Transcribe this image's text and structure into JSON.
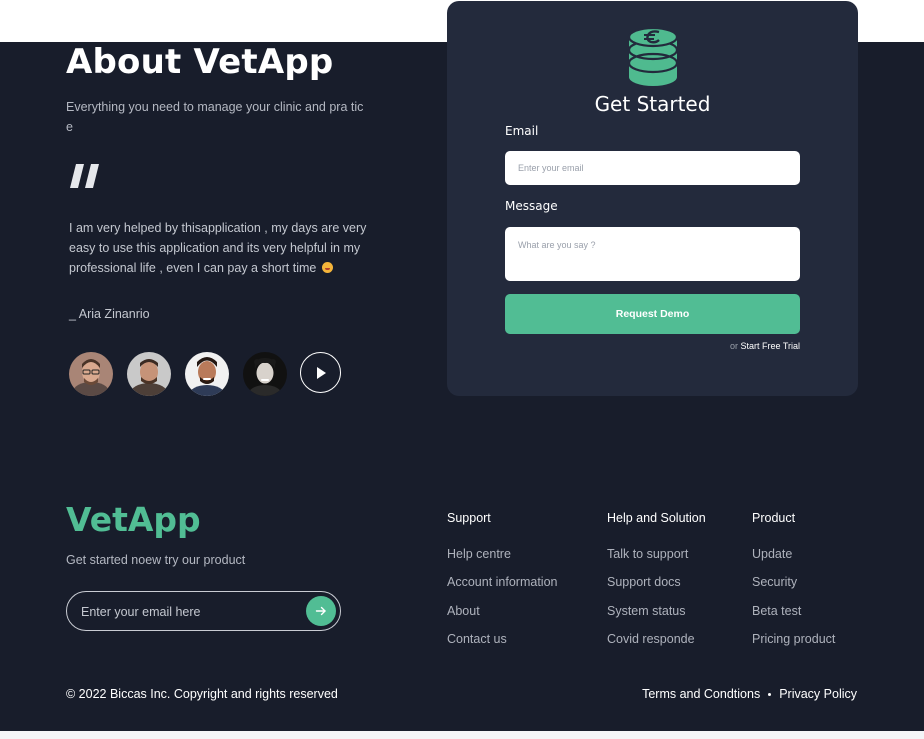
{
  "about": {
    "title": "About VetApp",
    "subtitle": "Everything you need to manage your clinic and pra tice",
    "testimonial": "I am very helped by thisapplication , my days are very easy to use this application and its very helpful in my professional  life , even I can pay a short time",
    "author": "_ Aria Zinanrio"
  },
  "form": {
    "title": "Get Started",
    "email_label": "Email",
    "email_placeholder": "Enter your email",
    "message_label": "Message",
    "message_placeholder": "What are you say ?",
    "submit_label": "Request Demo",
    "trial_prefix": "or",
    "trial_link": "Start Free Trial"
  },
  "footer": {
    "brand": "VetApp",
    "tagline": "Get started noew try our product",
    "subscribe_placeholder": "Enter your email here",
    "columns": [
      {
        "heading": "Support",
        "links": [
          "Help centre",
          "Account information",
          "About",
          "Contact us"
        ]
      },
      {
        "heading": "Help and Solution",
        "links": [
          "Talk to support",
          "Support docs",
          "System status",
          "Covid responde"
        ]
      },
      {
        "heading": "Product",
        "links": [
          "Update",
          "Security",
          "Beta test",
          "Pricing product"
        ]
      }
    ],
    "copyright": "© 2022 Biccas Inc. Copyright and rights reserved",
    "terms": "Terms and Condtions",
    "privacy": "Privacy Policy"
  },
  "colors": {
    "background": "#181d2b",
    "card": "#232a3c",
    "accent": "#51bd94"
  },
  "icons": [
    "quote-icon",
    "play-icon",
    "coin-stack-logo-icon",
    "arrow-right-icon"
  ]
}
